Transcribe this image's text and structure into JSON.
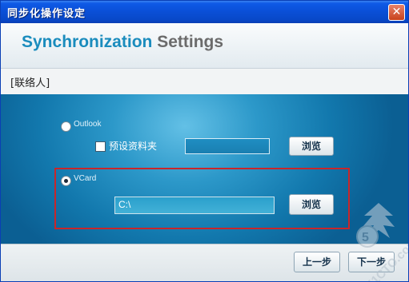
{
  "window": {
    "title": "同步化操作设定",
    "close_glyph": "✕"
  },
  "header": {
    "title_part1": "Synchronization",
    "title_part2": "Settings"
  },
  "breadcrumb": "[联络人]",
  "outlook": {
    "label": "Outlook",
    "selected": false,
    "default_folder_label": "预设资料夹",
    "default_folder_checked": false,
    "path_value": "",
    "browse_label": "浏览"
  },
  "vcard": {
    "label": "VCard",
    "selected": true,
    "path_value": "C:\\",
    "browse_label": "浏览"
  },
  "footer": {
    "back_label": "上一步",
    "next_label": "下一步"
  },
  "watermark": {
    "text": "51CTO.com"
  }
}
